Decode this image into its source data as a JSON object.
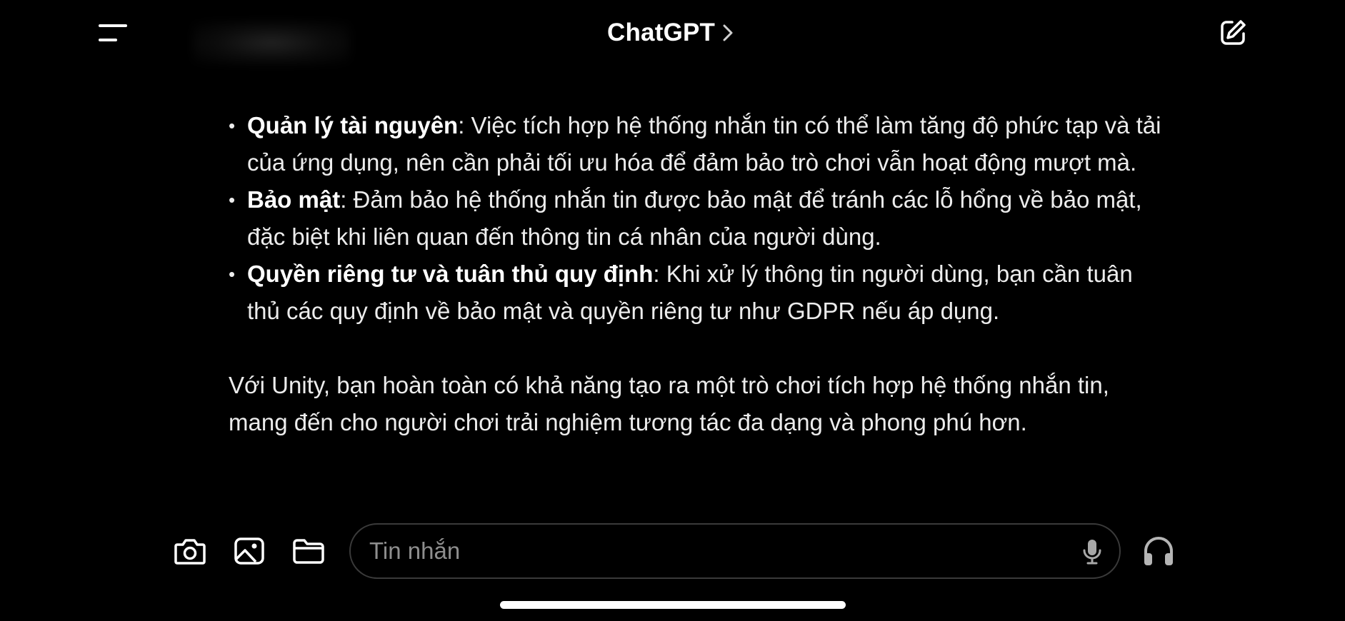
{
  "header": {
    "title": "ChatGPT",
    "title_chevron": "›",
    "menu_icon": "menu-icon",
    "new_chat_icon": "edit-icon"
  },
  "message": {
    "bullets": [
      {
        "title": "Quản lý tài nguyên",
        "text": ": Việc tích hợp hệ thống nhắn tin có thể làm tăng độ phức tạp và tải của ứng dụng, nên cần phải tối ưu hóa để đảm bảo trò chơi vẫn hoạt động mượt mà."
      },
      {
        "title": "Bảo mật",
        "text": ": Đảm bảo hệ thống nhắn tin được bảo mật để tránh các lỗ hổng về bảo mật, đặc biệt khi liên quan đến thông tin cá nhân của người dùng."
      },
      {
        "title": "Quyền riêng tư và tuân thủ quy định",
        "text": ": Khi xử lý thông tin người dùng, bạn cần tuân thủ các quy định về bảo mật và quyền riêng tư như GDPR nếu áp dụng."
      }
    ],
    "closing": "Với Unity, bạn hoàn toàn có khả năng tạo ra một trò chơi tích hợp hệ thống nhắn tin, mang đến cho người chơi trải nghiệm tương tác đa dạng và phong phú hơn."
  },
  "composer": {
    "placeholder": "Tin nhắn",
    "value": "",
    "tools": [
      "camera-icon",
      "photo-icon",
      "folder-icon"
    ],
    "mic_icon": "microphone-icon",
    "voice_icon": "headphones-icon"
  },
  "colors": {
    "background": "#000000",
    "text": "#ececec",
    "placeholder": "#8e8e8e",
    "input_border": "#3a3a3a"
  }
}
